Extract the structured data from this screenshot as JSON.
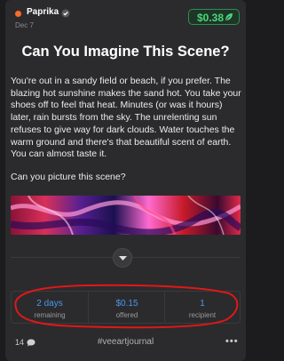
{
  "post": {
    "author": "Paprika",
    "date": "Dec 7",
    "price": "$0.38",
    "title": "Can You Imagine This Scene?",
    "paragraph": "You're out in a sandy field or beach, if you prefer. The blazing hot sunshine makes the sand hot. You take your shoes off to feel that heat. Minutes (or was it hours) later, rain bursts from the sky. The unrelenting sun refuses to give way for dark clouds. Water touches the warm ground and there's that beautiful scent of earth. You can almost taste it.",
    "question": "Can you picture this scene?"
  },
  "stats": [
    {
      "value": "2 days",
      "label": "remaining"
    },
    {
      "value": "$0.15",
      "label": "offered"
    },
    {
      "value": "1",
      "label": "recipient"
    }
  ],
  "footer": {
    "comments": "14",
    "tag": "#veeartjournal",
    "more": "•••"
  },
  "colors": {
    "accent_green": "#4ad67a",
    "stat_blue": "#4a98e8",
    "annotation_red": "#e01818",
    "avatar_orange": "#ff6a2b"
  },
  "icons": [
    "verified-check-icon",
    "leaf-icon",
    "chevron-down-icon",
    "comment-bubble-icon",
    "more-dots-icon"
  ]
}
